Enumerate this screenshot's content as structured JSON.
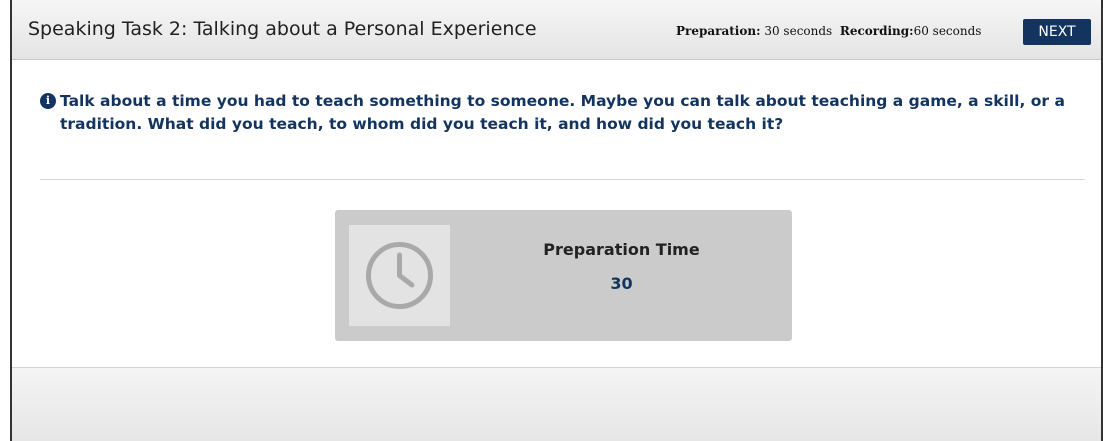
{
  "header": {
    "task_title": "Speaking Task 2: Talking about a Personal Experience",
    "preparation_label": "Preparation:",
    "preparation_value": "30 seconds",
    "recording_label": "Recording:",
    "recording_value": "60 seconds",
    "next_label": "NEXT"
  },
  "prompt": {
    "icon": "info-icon",
    "text": "Talk about a time you had to teach something to someone. Maybe you can talk about teaching a game, a skill, or a tradition. What did you teach, to whom did you teach it, and how did you teach it?"
  },
  "timer": {
    "icon": "clock-icon",
    "label": "Preparation Time",
    "value": "30"
  },
  "colors": {
    "accent": "#13345f",
    "panel": "#cbcbcb",
    "icon_box": "#e3e3e3"
  }
}
